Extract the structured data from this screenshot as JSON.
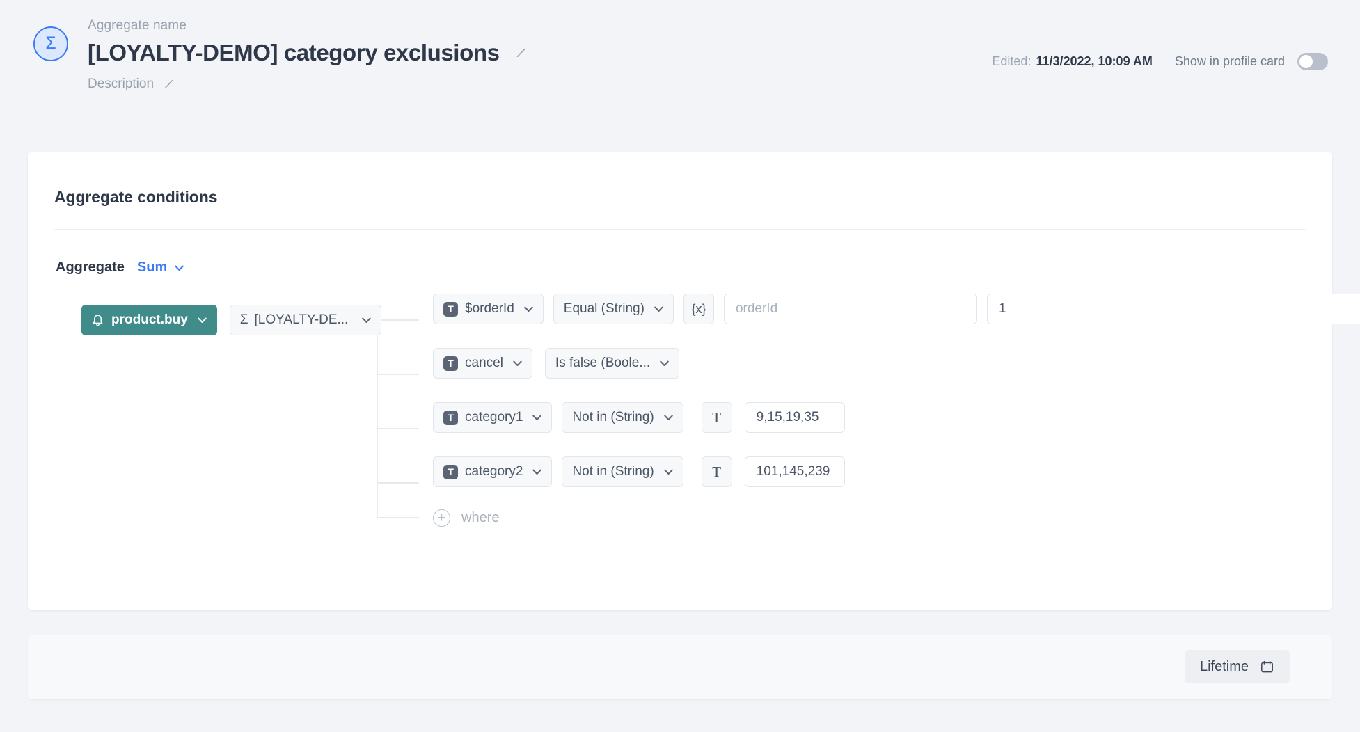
{
  "header": {
    "logo_icon": "sigma-icon",
    "logo_glyph": "Σ",
    "aggregate_name_label": "Aggregate name",
    "aggregate_name": "[LOYALTY-DEMO] category exclusions",
    "edit_title_icon": "pencil-icon",
    "description_label": "Description",
    "edit_description_icon": "pencil-icon",
    "edited_label": "Edited:",
    "edited_value": "11/3/2022, 10:09 AM",
    "show_in_profile_card_label": "Show in profile card",
    "show_in_profile_card_enabled": false
  },
  "card": {
    "title": "Aggregate conditions",
    "aggregate_word": "Aggregate",
    "aggregate_function": "Sum",
    "aggregate_caret_icon": "chevron-down-icon",
    "source": {
      "event_icon": "bell-icon",
      "event_label": "product.buy",
      "aggregate_icon": "sigma-icon",
      "aggregate_glyph": "Σ",
      "aggregate_label": "[LOYALTY-DE..."
    },
    "conditions": [
      {
        "field_icon": "text-type-icon",
        "field": "$orderId",
        "operator": "Equal (String)",
        "value_mode_icon": "expression-icon",
        "value_mode_glyph": "{x}",
        "value": "",
        "value_placeholder": "orderId",
        "extra_value": "1",
        "extra_value_placeholder": ""
      },
      {
        "field_icon": "text-type-icon",
        "field": "cancel",
        "operator": "Is false (Boole...",
        "value_mode_icon": null,
        "value": null
      },
      {
        "field_icon": "text-type-icon",
        "field": "category1",
        "operator": "Not in (String)",
        "value_mode_icon": "text-type-icon",
        "value_mode_glyph": "T",
        "value": "9,15,19,35"
      },
      {
        "field_icon": "text-type-icon",
        "field": "category2",
        "operator": "Not in (String)",
        "value_mode_icon": "text-type-icon",
        "value_mode_glyph": "T",
        "value": "101,145,239"
      }
    ],
    "add_where": {
      "icon": "plus-circle-icon",
      "label": "where"
    }
  },
  "footer": {
    "period_button_label": "Lifetime",
    "period_button_icon": "calendar-icon"
  },
  "colors": {
    "page_background": "#f2f4f7",
    "accent_blue": "#3b7cf6",
    "event_chip_teal": "#3f8c8a",
    "text_primary": "#2e3849",
    "text_muted": "#97a0ae"
  }
}
